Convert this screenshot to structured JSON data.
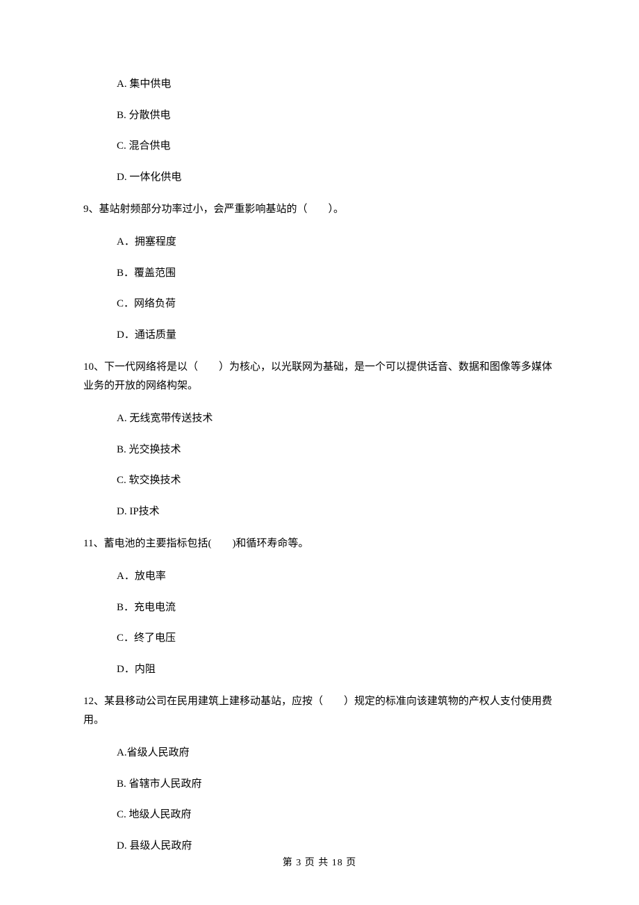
{
  "q8_options": {
    "a": "A. 集中供电",
    "b": "B. 分散供电",
    "c": "C. 混合供电",
    "d": "D. 一体化供电"
  },
  "q9": {
    "stem": "9、基站射频部分功率过小，会严重影响基站的（　　）。",
    "a": "A．拥塞程度",
    "b": "B．覆盖范围",
    "c": "C．网络负荷",
    "d": "D．通话质量"
  },
  "q10": {
    "stem": "10、下一代网络将是以（　　）为核心，以光联网为基础，是一个可以提供话音、数据和图像等多媒体业务的开放的网络构架。",
    "a": "A. 无线宽带传送技术",
    "b": "B. 光交换技术",
    "c": "C. 软交换技术",
    "d": "D. IP技术"
  },
  "q11": {
    "stem": "11、蓄电池的主要指标包括(　　)和循环寿命等。",
    "a": "A．放电率",
    "b": "B．充电电流",
    "c": "C．终了电压",
    "d": "D．内阻"
  },
  "q12": {
    "stem": "12、某县移动公司在民用建筑上建移动基站，应按（　　）规定的标准向该建筑物的产权人支付使用费用。",
    "a": "A.省级人民政府",
    "b": "B. 省辖市人民政府",
    "c": "C. 地级人民政府",
    "d": "D. 县级人民政府"
  },
  "footer": "第 3 页 共 18 页"
}
